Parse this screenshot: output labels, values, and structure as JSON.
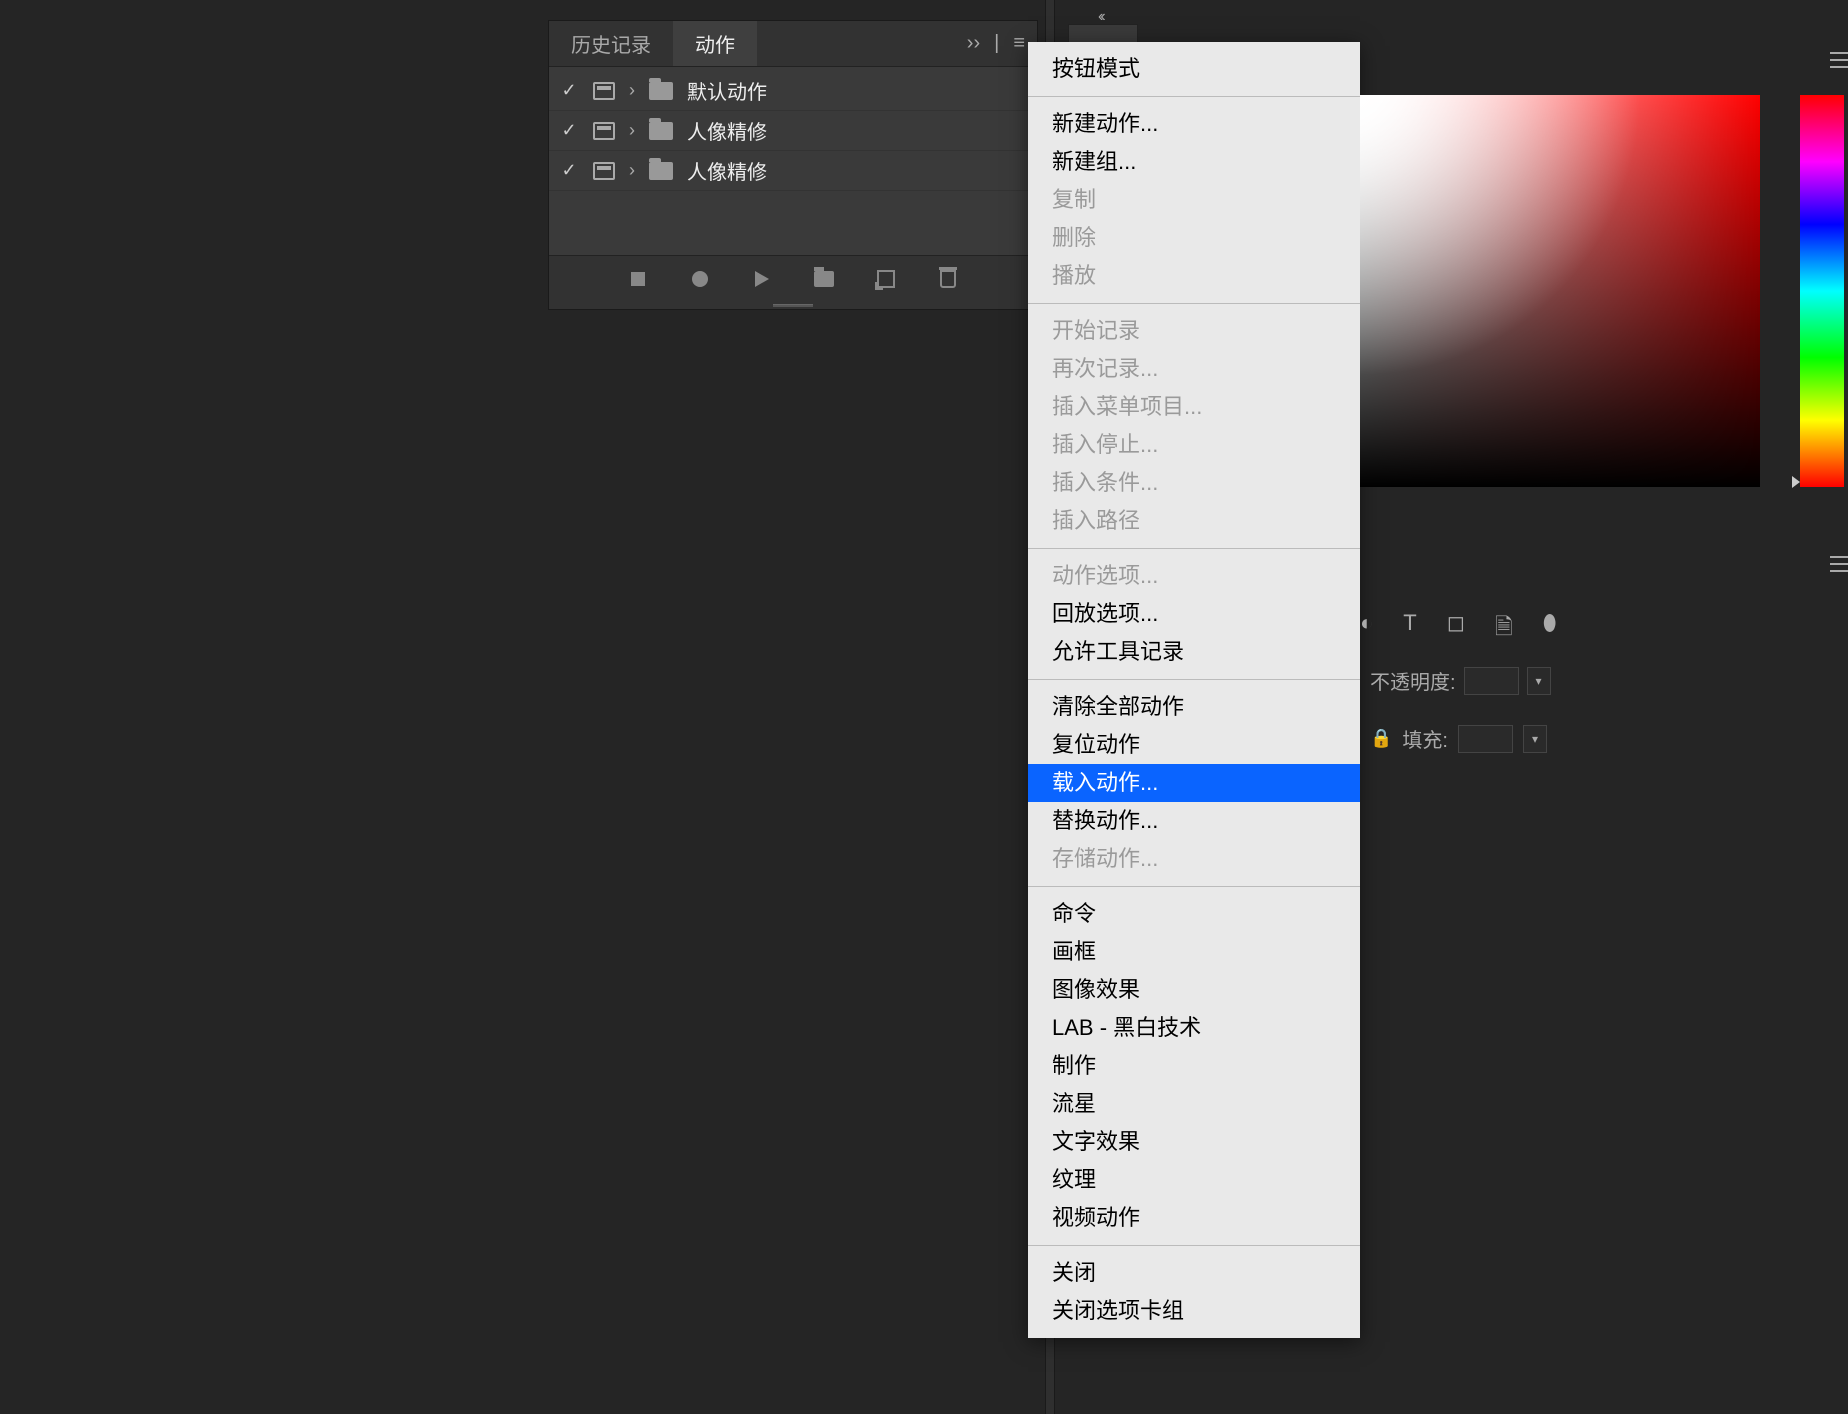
{
  "panel": {
    "tabs": {
      "history": "历史记录",
      "actions": "动作"
    },
    "rows": [
      {
        "label": "默认动作"
      },
      {
        "label": "人像精修"
      },
      {
        "label": "人像精修"
      }
    ]
  },
  "menu": {
    "items": [
      {
        "label": "按钮模式",
        "disabled": false
      },
      {
        "sep": true
      },
      {
        "label": "新建动作...",
        "disabled": false
      },
      {
        "label": "新建组...",
        "disabled": false
      },
      {
        "label": "复制",
        "disabled": true
      },
      {
        "label": "删除",
        "disabled": true
      },
      {
        "label": "播放",
        "disabled": true
      },
      {
        "sep": true
      },
      {
        "label": "开始记录",
        "disabled": true
      },
      {
        "label": "再次记录...",
        "disabled": true
      },
      {
        "label": "插入菜单项目...",
        "disabled": true
      },
      {
        "label": "插入停止...",
        "disabled": true
      },
      {
        "label": "插入条件...",
        "disabled": true
      },
      {
        "label": "插入路径",
        "disabled": true
      },
      {
        "sep": true
      },
      {
        "label": "动作选项...",
        "disabled": true
      },
      {
        "label": "回放选项...",
        "disabled": false
      },
      {
        "label": "允许工具记录",
        "disabled": false
      },
      {
        "sep": true
      },
      {
        "label": "清除全部动作",
        "disabled": false
      },
      {
        "label": "复位动作",
        "disabled": false
      },
      {
        "label": "载入动作...",
        "disabled": false,
        "highlight": true
      },
      {
        "label": "替换动作...",
        "disabled": false
      },
      {
        "label": "存储动作...",
        "disabled": true
      },
      {
        "sep": true
      },
      {
        "label": "命令",
        "disabled": false
      },
      {
        "label": "画框",
        "disabled": false
      },
      {
        "label": "图像效果",
        "disabled": false
      },
      {
        "label": "LAB - 黑白技术",
        "disabled": false
      },
      {
        "label": "制作",
        "disabled": false
      },
      {
        "label": "流星",
        "disabled": false
      },
      {
        "label": "文字效果",
        "disabled": false
      },
      {
        "label": "纹理",
        "disabled": false
      },
      {
        "label": "视频动作",
        "disabled": false
      },
      {
        "sep": true
      },
      {
        "label": "关闭",
        "disabled": false
      },
      {
        "label": "关闭选项卡组",
        "disabled": false
      }
    ]
  },
  "right": {
    "opacity_label": "不透明度:",
    "fill_label": "填充:"
  }
}
